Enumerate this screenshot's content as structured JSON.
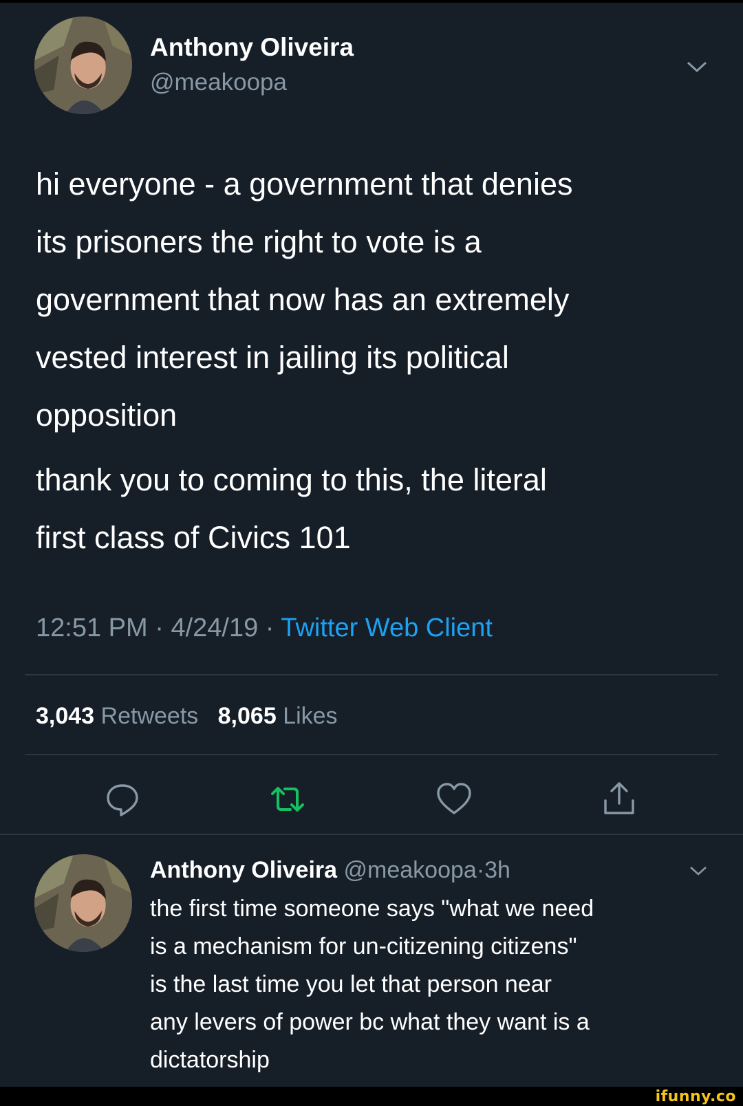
{
  "tweet": {
    "author_name": "Anthony Oliveira",
    "author_handle": "@meakoopa",
    "text_lines": [
      "hi everyone - a government that denies",
      "its prisoners the right to vote is a",
      "government that now has an extremely",
      "vested interest in jailing its political",
      "opposition"
    ],
    "text2_lines": [
      "thank you to coming to this, the literal",
      "first class of Civics 101"
    ],
    "time": "12:51 PM",
    "date": "4/24/19",
    "separator": "·",
    "client": "Twitter Web Client",
    "retweet_count": "3,043",
    "retweet_label": "Retweets",
    "like_count": "8,065",
    "like_label": "Likes"
  },
  "actions": {
    "icons": [
      "reply-icon",
      "retweet-icon",
      "like-icon",
      "share-icon"
    ],
    "retweet_color": "#17bf63"
  },
  "reply": {
    "author_name": "Anthony Oliveira",
    "author_handle": "@meakoopa",
    "separator": "·",
    "age": "3h",
    "text_lines": [
      "the first time someone says \"what we need",
      "is a mechanism for un-citizening citizens\"",
      "is the last time you let that person near",
      "any levers of power bc what they want is a",
      "dictatorship"
    ]
  },
  "watermark": "ifunny.co",
  "colors": {
    "background": "#161e28",
    "text": "#ffffff",
    "muted": "#8899a6",
    "link": "#1da1f2"
  }
}
